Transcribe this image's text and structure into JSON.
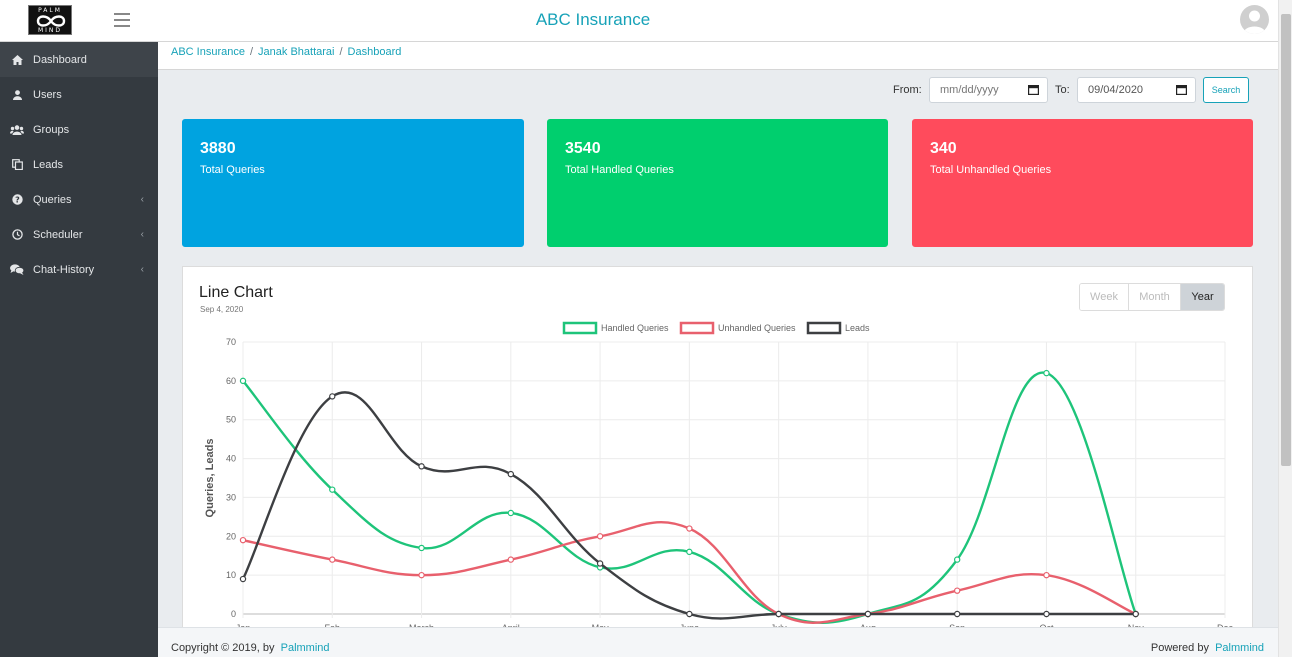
{
  "header": {
    "logo_top": "PALM",
    "logo_bottom": "MIND",
    "app_title": "ABC Insurance"
  },
  "sidebar": {
    "items": [
      {
        "label": "Dashboard",
        "icon": "home-icon",
        "active": true,
        "has_submenu": false
      },
      {
        "label": "Users",
        "icon": "user-icon",
        "active": false,
        "has_submenu": false
      },
      {
        "label": "Groups",
        "icon": "users-icon",
        "active": false,
        "has_submenu": false
      },
      {
        "label": "Leads",
        "icon": "copy-icon",
        "active": false,
        "has_submenu": false
      },
      {
        "label": "Queries",
        "icon": "question-circle-icon",
        "active": false,
        "has_submenu": true
      },
      {
        "label": "Scheduler",
        "icon": "clock-icon",
        "active": false,
        "has_submenu": true
      },
      {
        "label": "Chat-History",
        "icon": "comments-icon",
        "active": false,
        "has_submenu": true
      }
    ]
  },
  "breadcrumb": [
    "ABC Insurance",
    "Janak Bhattarai",
    "Dashboard"
  ],
  "filters": {
    "from_label": "From:",
    "from_placeholder": "mm/dd/yyyy",
    "to_label": "To:",
    "to_value": "09/04/2020",
    "search_label": "Search"
  },
  "cards": [
    {
      "value": "3880",
      "label": "Total Queries",
      "color": "#00a3e0"
    },
    {
      "value": "3540",
      "label": "Total Handled Queries",
      "color": "#00cf6e"
    },
    {
      "value": "340",
      "label": "Total Unhandled Queries",
      "color": "#ff4b5c"
    }
  ],
  "chart_panel": {
    "title": "Line Chart",
    "date": "Sep 4, 2020",
    "range_buttons": [
      "Week",
      "Month",
      "Year"
    ],
    "active_range": "Year"
  },
  "chart_data": {
    "type": "line",
    "categories": [
      "Jan",
      "Feb",
      "March",
      "April",
      "May",
      "June",
      "July",
      "Aug",
      "Sep",
      "Oct",
      "Nov",
      "Dec"
    ],
    "series": [
      {
        "name": "Handled Queries",
        "color": "#1ec47a",
        "values": [
          60,
          32,
          17,
          26,
          12,
          16,
          0,
          0,
          14,
          62,
          0
        ]
      },
      {
        "name": "Unhandled Queries",
        "color": "#e8606d",
        "values": [
          19,
          14,
          10,
          14,
          20,
          22,
          0,
          0,
          6,
          10,
          0
        ]
      },
      {
        "name": "Leads",
        "color": "#3d3f42",
        "values": [
          9,
          56,
          38,
          36,
          13,
          0,
          0,
          0,
          0,
          0,
          0
        ]
      }
    ],
    "ylabel": "Queries, Leads",
    "ylim": [
      0,
      70
    ],
    "yticks": [
      0,
      10,
      20,
      30,
      40,
      50,
      60,
      70
    ],
    "grid": true,
    "legend": "top-center"
  },
  "footer": {
    "copyright": "Copyright © 2019, by",
    "company": "Palmmind",
    "powered_label": "Powered by",
    "powered_company": "Palmmind"
  }
}
